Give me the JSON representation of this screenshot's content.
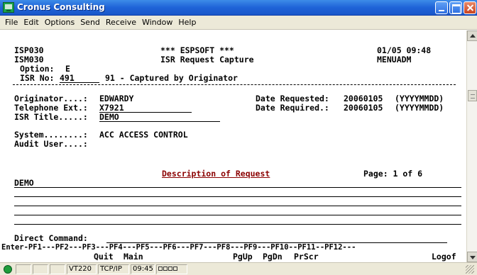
{
  "window": {
    "title": "Cronus Consulting"
  },
  "menu": [
    "File",
    "Edit",
    "Options",
    "Send",
    "Receive",
    "Window",
    "Help"
  ],
  "screen": {
    "program_id": "ISP030",
    "screen_id": "ISM030",
    "system_banner": "*** ESPSOFT ***",
    "screen_title": "ISR Request Capture",
    "date_time": "01/05 09:48",
    "menu_id": "MENUADM",
    "option_label": "Option:",
    "option_value": "E",
    "isr_label": "ISR No:",
    "isr_number": "491",
    "isr_status": "91 - Captured by Originator",
    "originator_label": "Originator....:",
    "originator_value": "EDWARDY",
    "telephone_label": "Telephone Ext.:",
    "telephone_value": "X7921",
    "isr_title_label": "ISR Title.....:",
    "isr_title_value": "DEMO",
    "date_requested_label": "Date Requested:",
    "date_requested_value": "20060105",
    "date_required_label": "Date Required.:",
    "date_required_value": "20060105",
    "date_format": "(YYYYMMDD)",
    "system_label": "System........:",
    "system_value": "ACC ACCESS CONTROL",
    "audit_user_label": "Audit User....:",
    "audit_user_value": "",
    "description_header": "Description of Request",
    "page_indicator": "Page: 1 of 6",
    "description_lines": [
      "DEMO",
      "",
      "",
      "",
      ""
    ],
    "direct_command_label": "Direct Command:",
    "fkey_row": "Enter-PF1---PF2---PF3---PF4---PF5---PF6---PF7---PF8---PF9---PF10--PF11--PF12---",
    "fkey_labels": {
      "pf3": "Quit",
      "pf4": "Main",
      "pf7": "PgUp",
      "pf8": "PgDn",
      "pf9": "PrScr",
      "pf12": "Logof"
    }
  },
  "statusbar": {
    "terminal_type": "VT220",
    "protocol": "TCP/IP",
    "time": "09:45"
  }
}
